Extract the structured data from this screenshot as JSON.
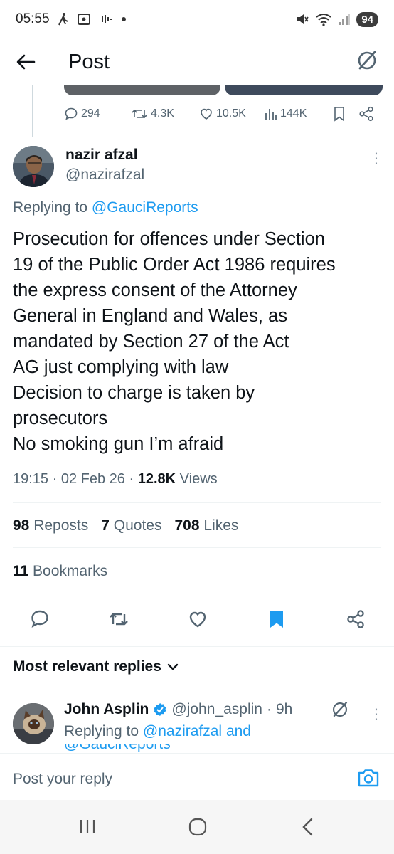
{
  "status_bar": {
    "time": "05:55",
    "battery": "94",
    "left_icons": [
      "walking-icon",
      "screen-record-icon",
      "voice-icon",
      "dot-icon"
    ],
    "right_icons": [
      "mute-icon",
      "wifi-icon",
      "signal-icon"
    ]
  },
  "nav": {
    "title": "Post",
    "back_icon": "back-arrow-icon",
    "right_icon": "grok-icon"
  },
  "previous_post": {
    "replies": "294",
    "reposts": "4.3K",
    "likes": "10.5K",
    "views": "144K"
  },
  "post": {
    "author_name": "nazir afzal",
    "author_handle": "@nazirafzal",
    "replying_prefix": "Replying to",
    "replying_handle": "@GauciReports",
    "lines": [
      "Prosecution for offences under Section",
      "19 of the Public Order Act 1986 requires",
      "the express consent of the Attorney",
      "General in England and Wales, as",
      "mandated by Section 27 of the Act",
      "AG just complying with law",
      "Decision to charge is taken by",
      "prosecutors",
      "No smoking gun I’m afraid"
    ],
    "time": "19:15",
    "date": "02 Feb 26",
    "views_count": "12.8K",
    "views_label": "Views",
    "reposts_count": "98",
    "reposts_label": "Reposts",
    "quotes_count": "7",
    "quotes_label": "Quotes",
    "likes_count": "708",
    "likes_label": "Likes",
    "bookmarks_count": "11",
    "bookmarks_label": "Bookmarks"
  },
  "replies_section": {
    "title": "Most relevant replies"
  },
  "reply": {
    "name": "John Asplin",
    "handle": "@john_asplin",
    "age": "9h",
    "replying_prefix": "Replying to",
    "replying_handle": "@nazirafzal",
    "and": "and",
    "second_handle": "@GauciReports"
  },
  "compose": {
    "placeholder": "Post your reply"
  },
  "colors": {
    "accent": "#1d9bf0",
    "muted": "#536471",
    "text": "#0f1419",
    "bookmark_active": "#1d9bf0"
  }
}
